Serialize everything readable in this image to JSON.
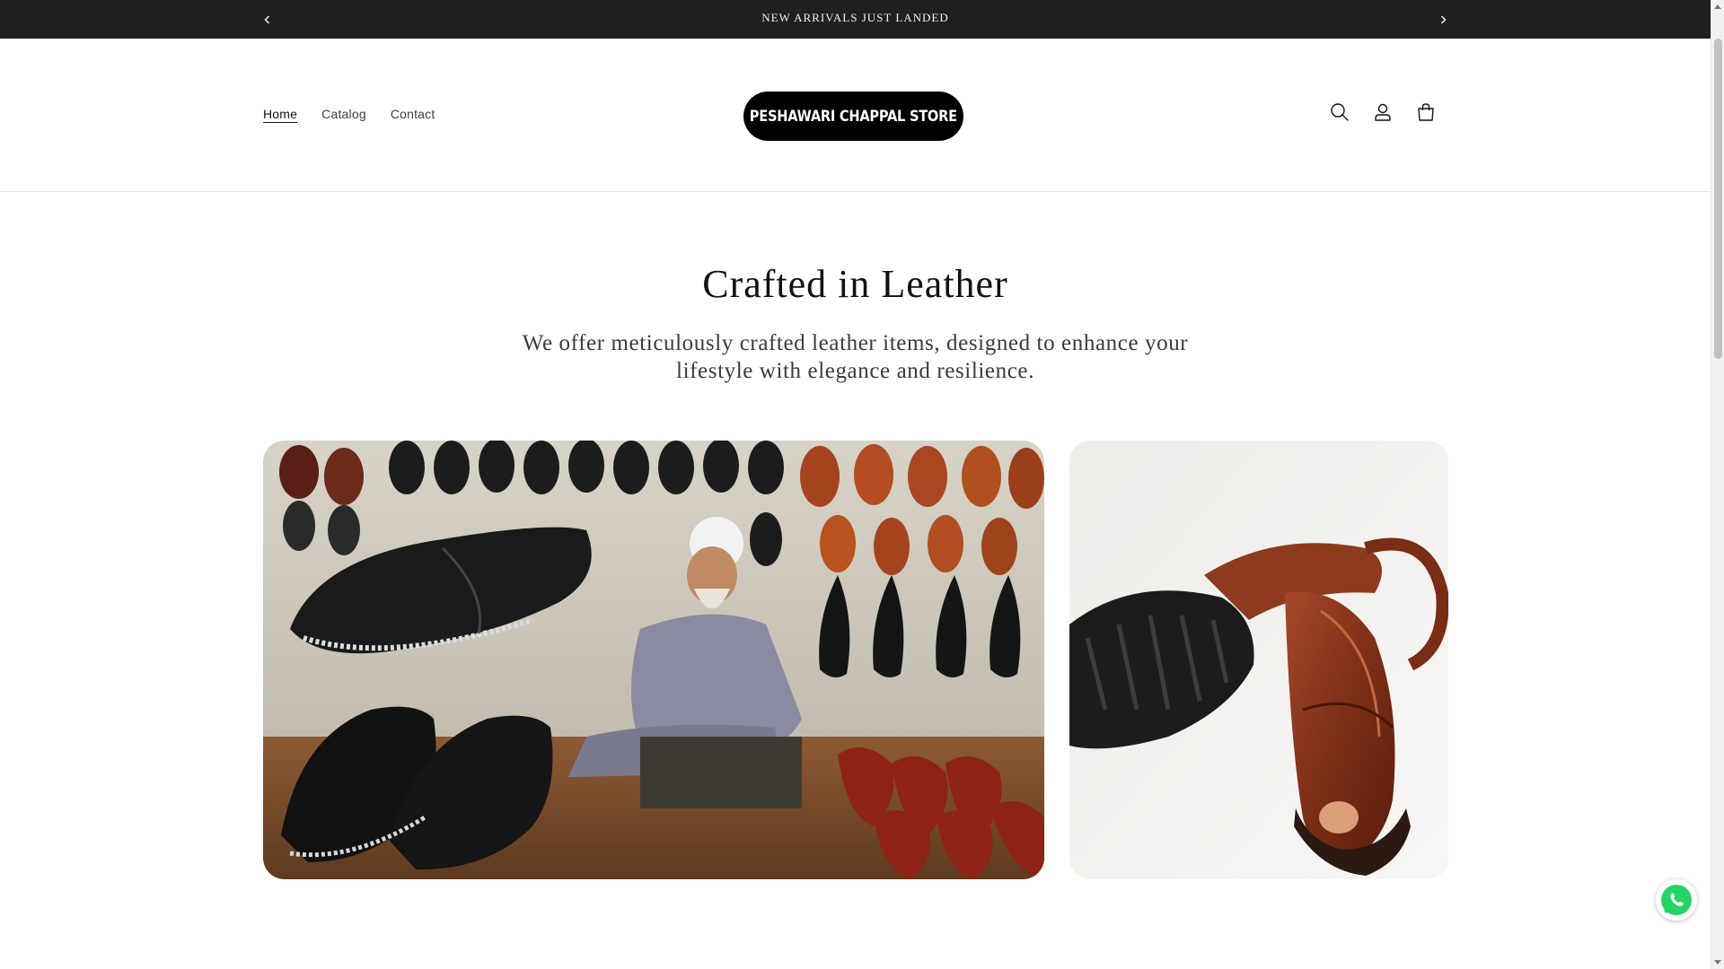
{
  "announcement": {
    "text": "NEW ARRIVALS JUST LANDED",
    "prev_icon": "chevron-left-icon",
    "next_icon": "chevron-right-icon"
  },
  "header": {
    "nav": [
      {
        "label": "Home",
        "active": true
      },
      {
        "label": "Catalog",
        "active": false
      },
      {
        "label": "Contact",
        "active": false
      }
    ],
    "logo_text": "PESHAWARI CHAPPAL STORE",
    "icons": [
      "search-icon",
      "account-icon",
      "cart-icon"
    ]
  },
  "hero": {
    "title": "Crafted in Leather",
    "subtitle": "We offer meticulously crafted leather items, designed to enhance your lifestyle with elegance and resilience."
  },
  "colors": {
    "announcement_bg": "#1f1f1f",
    "logo_bg": "#000000",
    "leather_brown": "#8b3a1a",
    "whatsapp_green": "#25d366"
  },
  "floating": {
    "whatsapp_icon": "whatsapp-icon"
  }
}
